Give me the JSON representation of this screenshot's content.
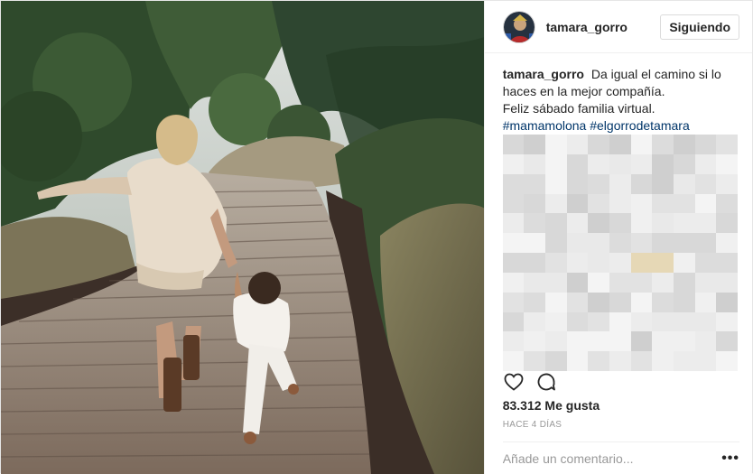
{
  "header": {
    "username": "tamara_gorro",
    "follow_label": "Siguiendo"
  },
  "caption": {
    "username": "tamara_gorro",
    "line1": "Da igual el camino si lo haces en la mejor compañía.",
    "line2": "Feliz sábado familia virtual.",
    "hashtags": [
      "#mamamolona",
      "#elgorrodetamara"
    ]
  },
  "engagement": {
    "likes": "83.312 Me gusta",
    "timestamp": "HACE 4 DÍAS"
  },
  "comment_box": {
    "placeholder": "Añade un comentario...",
    "more": "•••"
  },
  "icons": {
    "like": "heart-icon",
    "comment": "comment-icon",
    "more": "more-options-icon"
  },
  "colors": {
    "hashtag": "#003569",
    "follow_border": "#dbdbdb",
    "muted": "#999999"
  }
}
